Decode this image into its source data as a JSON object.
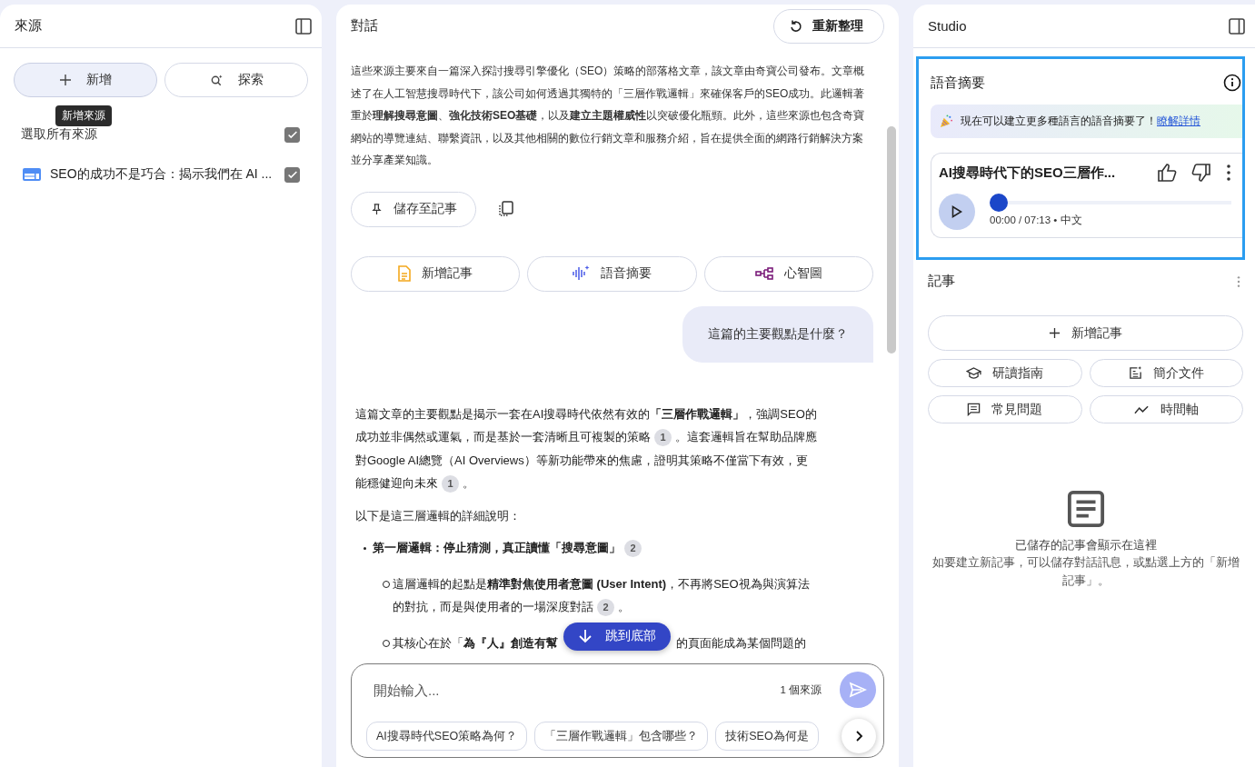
{
  "sources_panel": {
    "title": "來源",
    "add_button": "新增",
    "discover_button": "探索",
    "tooltip": "新增來源",
    "select_all": {
      "label": "選取所有來源",
      "checked": true
    },
    "sources": [
      {
        "title": "SEO的成功不是巧合：揭示我們在 AI ...",
        "checked": true
      }
    ]
  },
  "chat_panel": {
    "title": "對話",
    "refresh_button": "重新整理",
    "summary": "這些來源主要來自一篇深入探討搜尋引擎優化（SEO）策略的部落格文章，該文章由奇寶公司發布。文章概述了在人工智慧搜尋時代下，該公司如何透過其獨特的「三層作戰邏輯」來確保客戶的SEO成功。此邏輯著重於**理解搜尋意圖**、**強化技術SEO基礎**，以及**建立主題權威性**以突破優化瓶頸。此外，這些來源也包含奇寶網站的導覽連結、聯繫資訊，以及其他相關的數位行銷文章和服務介紹，旨在提供全面的網路行銷解決方案並分享產業知識。",
    "save_button": "儲存至記事",
    "actions": [
      {
        "kind": "note",
        "label": "新增記事"
      },
      {
        "kind": "audio",
        "label": "語音摘要"
      },
      {
        "kind": "mindmap",
        "label": "心智圖"
      }
    ],
    "user_message": "這篇的主要觀點是什麼？",
    "answer": [
      {
        "kind": "paragraph",
        "parts": [
          {
            "kind": "text",
            "text": "這篇文章的主要觀點是揭示一套在AI搜尋時代依然有效的**「三層作戰邏輯」**，強調SEO的成功並非偶然或運氣，而是基於一套清晰且可複製的策略"
          },
          {
            "kind": "cite",
            "label": "1"
          },
          {
            "kind": "text",
            "text": "。這套邏輯旨在幫助品牌應對Google AI總覽（AI Overviews）等新功能帶來的焦慮，證明其策略不僅當下有效，更能穩健迎向未來"
          },
          {
            "kind": "cite",
            "label": "1"
          },
          {
            "kind": "text",
            "text": "。"
          }
        ]
      },
      {
        "kind": "paragraph",
        "parts": [
          {
            "kind": "text",
            "text": "以下是這三層邏輯的詳細說明："
          }
        ]
      },
      {
        "kind": "bullet",
        "parts": [
          {
            "kind": "text",
            "text": "第一層邏輯：停止猜測，真正讀懂「搜尋意圖」"
          },
          {
            "kind": "cite",
            "label": "2"
          }
        ],
        "children": [
          {
            "kind": "sub-bullet",
            "parts": [
              {
                "kind": "text",
                "text": "這層邏輯的起點是**精準對焦使用者意圖 (User Intent)**，不再將SEO視為與演算法的對抗，而是與使用者的一場深度對話"
              },
              {
                "kind": "cite",
                "label": "2"
              },
              {
                "kind": "text",
                "text": "。"
              }
            ]
          },
          {
            "kind": "sub-bullet",
            "parts": [
              {
                "kind": "text",
                "text": "其核心在於「**為『人』創造有幫**"
              },
              {
                "kind": "fragment",
                "text": "的頁面能成為某個問題的"
              }
            ]
          }
        ]
      }
    ],
    "jump_button": "跳到底部",
    "input": {
      "placeholder": "開始輸入...",
      "source_count": "1 個來源"
    },
    "suggestions": [
      "AI搜尋時代SEO策略為何？",
      "「三層作戰邏輯」包含哪些？",
      "技術SEO為何是"
    ]
  },
  "studio_panel": {
    "title": "Studio",
    "audio": {
      "title": "語音摘要",
      "banner": "現在可以建立更多種語言的語音摘要了！",
      "banner_link": "瞭解詳情",
      "card_title": "AI搜尋時代下的SEO三層作...",
      "level": 0,
      "time": "00:00 / 07:13 • 中文"
    },
    "notes": {
      "title": "記事",
      "add_button": "新增記事",
      "tools": [
        {
          "kind": "study",
          "label": "研讀指南"
        },
        {
          "kind": "brief",
          "label": "簡介文件"
        },
        {
          "kind": "faq",
          "label": "常見問題"
        },
        {
          "kind": "timeline",
          "label": "時間軸"
        }
      ],
      "empty_title": "已儲存的記事會顯示在這裡",
      "empty_text": "如要建立新記事，可以儲存對話訊息，或點選上方的「新增記事」。"
    }
  }
}
